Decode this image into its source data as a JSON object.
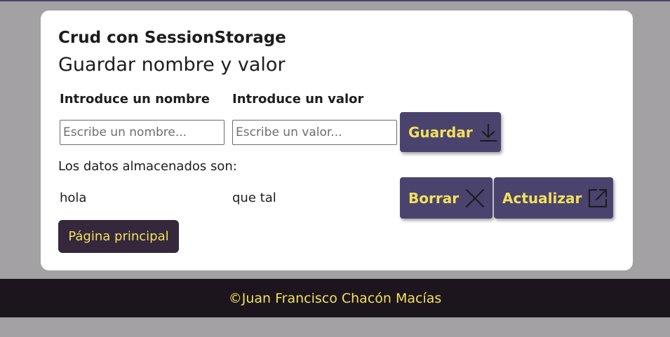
{
  "colors": {
    "page_background": "#a3a1a3",
    "card_background": "#ffffff",
    "button_primary": "#4a436e",
    "button_text": "#f2e15b",
    "home_button": "#35283d",
    "footer_background": "#1c151d"
  },
  "header": {
    "title": "Crud con SessionStorage",
    "subtitle": "Guardar nombre y valor"
  },
  "form": {
    "name_label": "Introduce un nombre",
    "name_placeholder": "Escribe un nombre...",
    "value_label": "Introduce un valor",
    "value_placeholder": "Escribe un valor...",
    "save_label": "Guardar",
    "save_icon": "download-arrow-icon"
  },
  "stored": {
    "label": "Los datos almacenados son:",
    "rows": [
      {
        "name": "hola",
        "value": "que tal",
        "delete_label": "Borrar",
        "delete_icon": "close-icon",
        "update_label": "Actualizar",
        "update_icon": "external-link-icon"
      }
    ]
  },
  "nav": {
    "home_label": "Página principal"
  },
  "footer": {
    "text": "©Juan Francisco Chacón Macías"
  }
}
